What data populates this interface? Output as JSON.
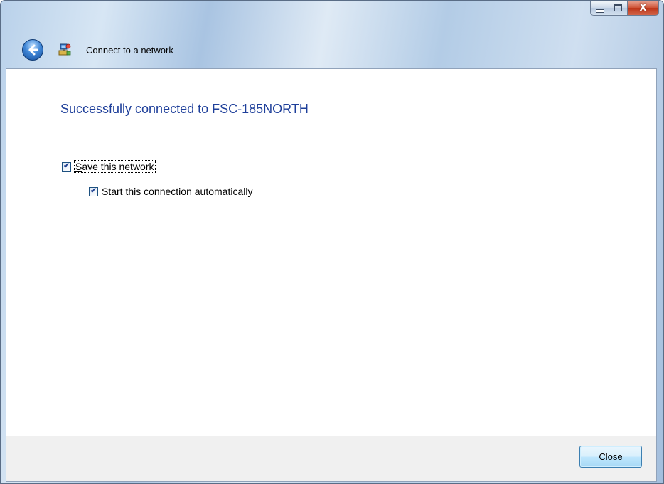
{
  "window": {
    "title": "Connect to a network",
    "caption": {
      "minimize": "minimize",
      "maximize": "maximize",
      "close": "X"
    }
  },
  "content": {
    "heading": "Successfully connected to FSC-185NORTH",
    "options": [
      {
        "label_first": "S",
        "label_rest": "ave this network",
        "checked": true
      },
      {
        "label_first": "S",
        "label_underlined": "t",
        "label_rest": "art this connection automatically",
        "checked": true
      }
    ]
  },
  "footer": {
    "close_first": "C",
    "close_underlined": "l",
    "close_rest": "ose"
  },
  "colors": {
    "heading": "#1e3f9a",
    "button_border": "#3c7fb1",
    "close_caption": "#c2391b"
  }
}
